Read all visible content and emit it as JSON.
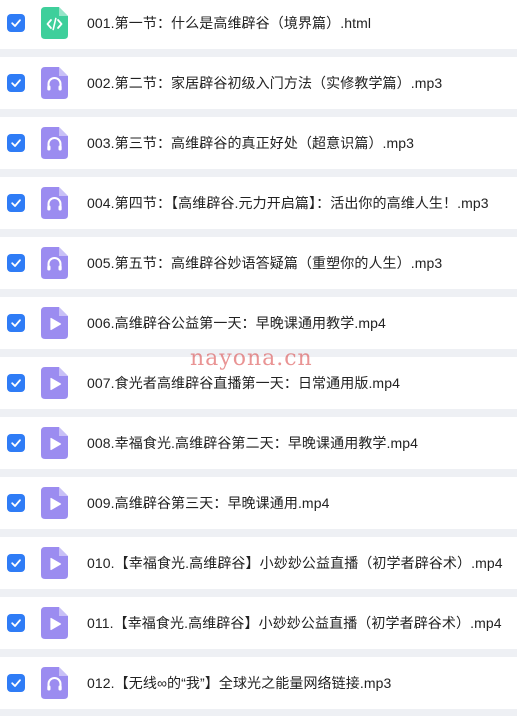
{
  "colors": {
    "background": "#eef0f4",
    "row_background": "#ffffff",
    "checkbox": "#2f7cf6",
    "html_icon": "#3ecf9b",
    "audio_icon": "#9b8cf0",
    "video_icon": "#9b8cf0",
    "watermark": "#d73c3c"
  },
  "watermark": "nayona.cn",
  "files": [
    {
      "name": "001.第一节：什么是高维辟谷（境界篇）.html",
      "type": "html",
      "icon": "code-file-icon",
      "checked": true
    },
    {
      "name": "002.第二节：家居辟谷初级入门方法（实修教学篇）.mp3",
      "type": "audio",
      "icon": "headphones-file-icon",
      "checked": true
    },
    {
      "name": "003.第三节：高维辟谷的真正好处（超意识篇）.mp3",
      "type": "audio",
      "icon": "headphones-file-icon",
      "checked": true
    },
    {
      "name": "004.第四节：【高维辟谷.元力开启篇】：活出你的高维人生！.mp3",
      "type": "audio",
      "icon": "headphones-file-icon",
      "checked": true
    },
    {
      "name": "005.第五节：高维辟谷妙语答疑篇（重塑你的人生）.mp3",
      "type": "audio",
      "icon": "headphones-file-icon",
      "checked": true
    },
    {
      "name": "006.高维辟谷公益第一天：早晚课通用教学.mp4",
      "type": "video",
      "icon": "play-file-icon",
      "checked": true
    },
    {
      "name": "007.食光者高维辟谷直播第一天：日常通用版.mp4",
      "type": "video",
      "icon": "play-file-icon",
      "checked": true
    },
    {
      "name": "008.幸福食光.高维辟谷第二天：早晚课通用教学.mp4",
      "type": "video",
      "icon": "play-file-icon",
      "checked": true
    },
    {
      "name": "009.高维辟谷第三天：早晚课通用.mp4",
      "type": "video",
      "icon": "play-file-icon",
      "checked": true
    },
    {
      "name": "010.【幸福食光.高维辟谷】小玅玅公益直播（初学者辟谷术）.mp4",
      "type": "video",
      "icon": "play-file-icon",
      "checked": true
    },
    {
      "name": "011.【幸福食光.高维辟谷】小玅玅公益直播（初学者辟谷术）.mp4",
      "type": "video",
      "icon": "play-file-icon",
      "checked": true
    },
    {
      "name": "012.【无线∞的“我”】全球光之能量网络链接.mp3",
      "type": "audio",
      "icon": "headphones-file-icon",
      "checked": true
    }
  ]
}
